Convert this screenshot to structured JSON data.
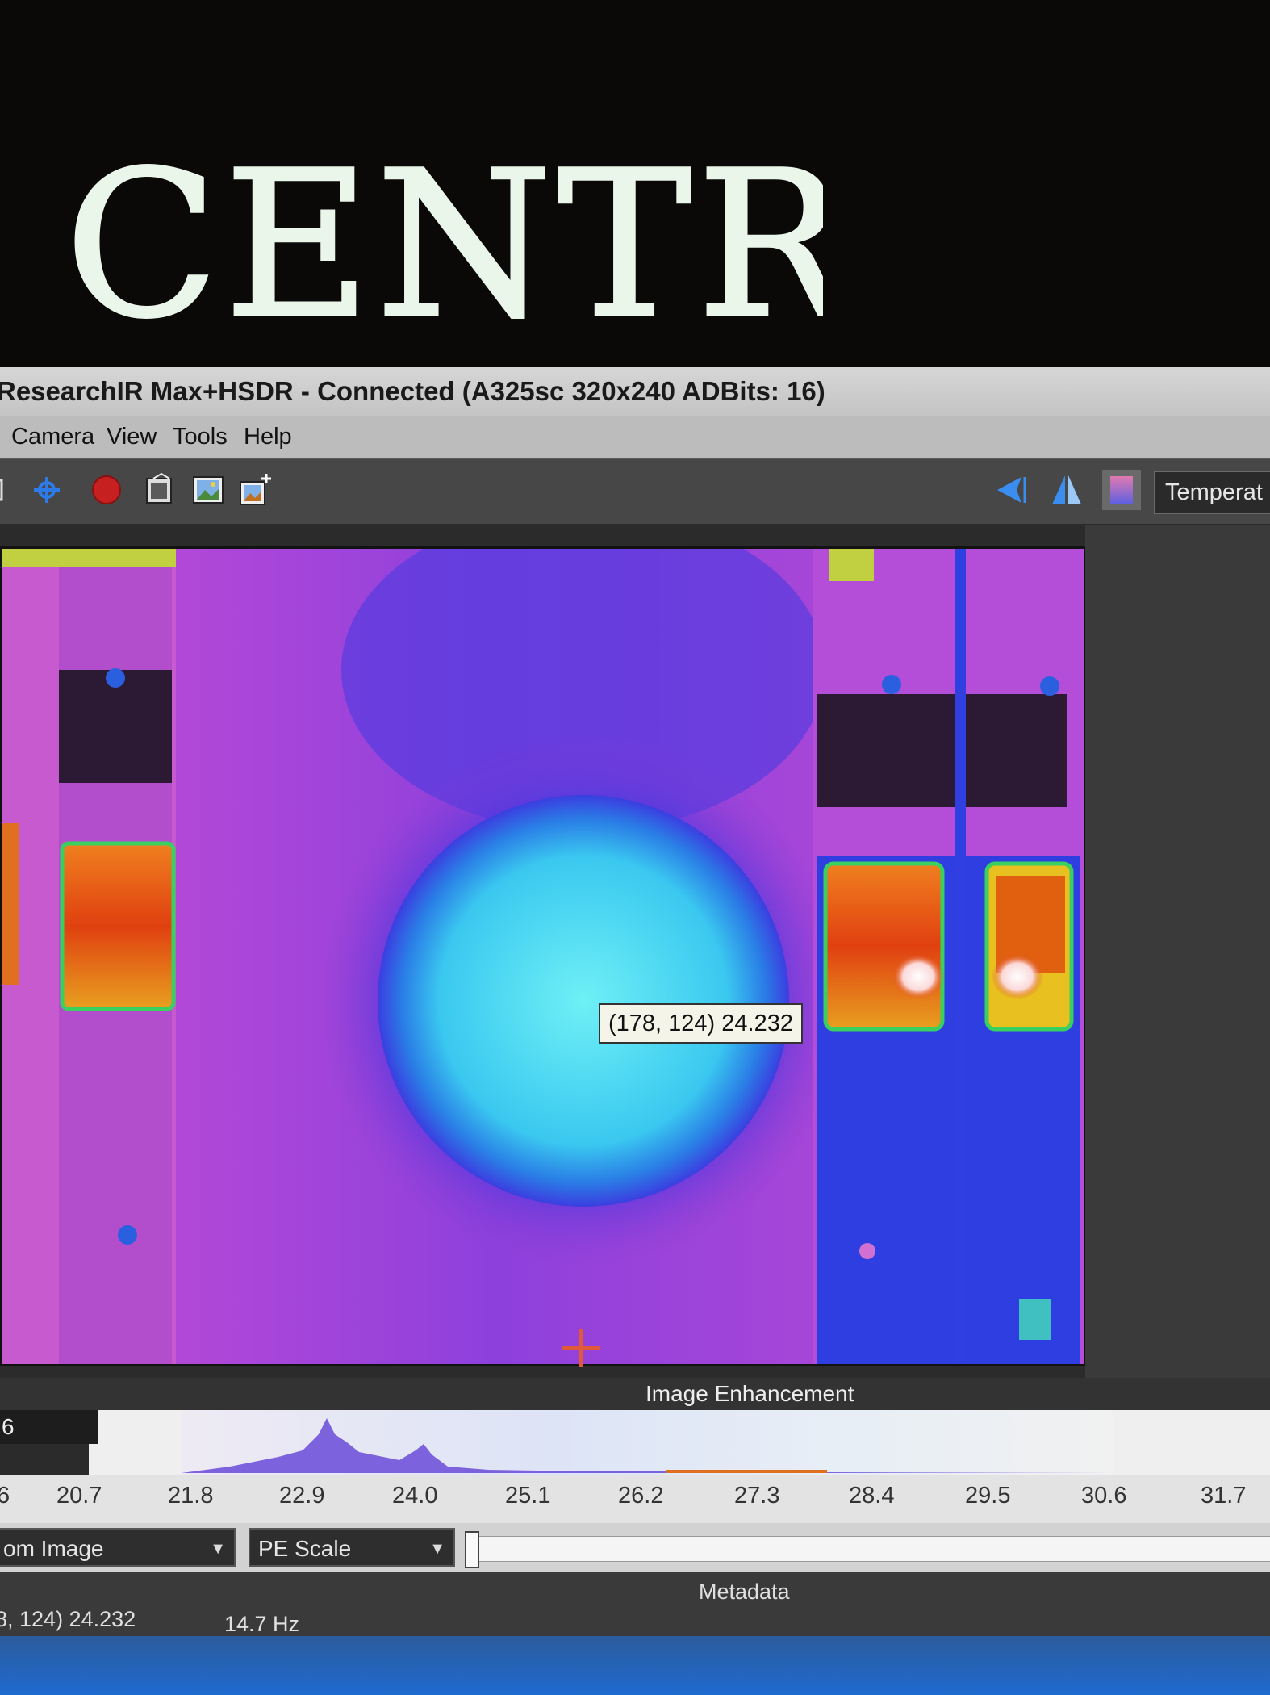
{
  "overlay": {
    "caption": "CENTRAL"
  },
  "window": {
    "title": "ResearchIR Max+HSDR - Connected (A325sc 320x240 ADBits: 16)"
  },
  "menu": {
    "items": [
      "Camera",
      "View",
      "Tools",
      "Help"
    ]
  },
  "toolbar": {
    "icons": [
      "connect-icon",
      "focus-icon",
      "record-icon",
      "capture-icon",
      "image-icon",
      "image-add-icon",
      "flip-horizontal-icon",
      "flip-vertical-icon",
      "palette-icon"
    ],
    "record_color": "#c62020",
    "unit_select": "Temperat"
  },
  "thermal_view": {
    "cursor_readout": "(178, 124) 24.232",
    "palette": [
      "#2a1530",
      "#5b2bd8",
      "#a24ad8",
      "#e070e0",
      "#2aa8e0",
      "#7ef0f0",
      "#e8d020",
      "#e06010",
      "#ffffff"
    ]
  },
  "enhancement": {
    "title": "Image Enhancement",
    "range_value": "6",
    "ticks": [
      "6",
      "20.7",
      "21.8",
      "22.9",
      "24.0",
      "25.1",
      "26.2",
      "27.3",
      "28.4",
      "29.5",
      "30.6",
      "31.7"
    ],
    "source_dropdown": "om Image",
    "scale_dropdown": "PE Scale"
  },
  "status": {
    "metadata_label": "Metadata",
    "cursor_value": "8, 124) 24.232",
    "frame_rate": "14.7 Hz"
  }
}
